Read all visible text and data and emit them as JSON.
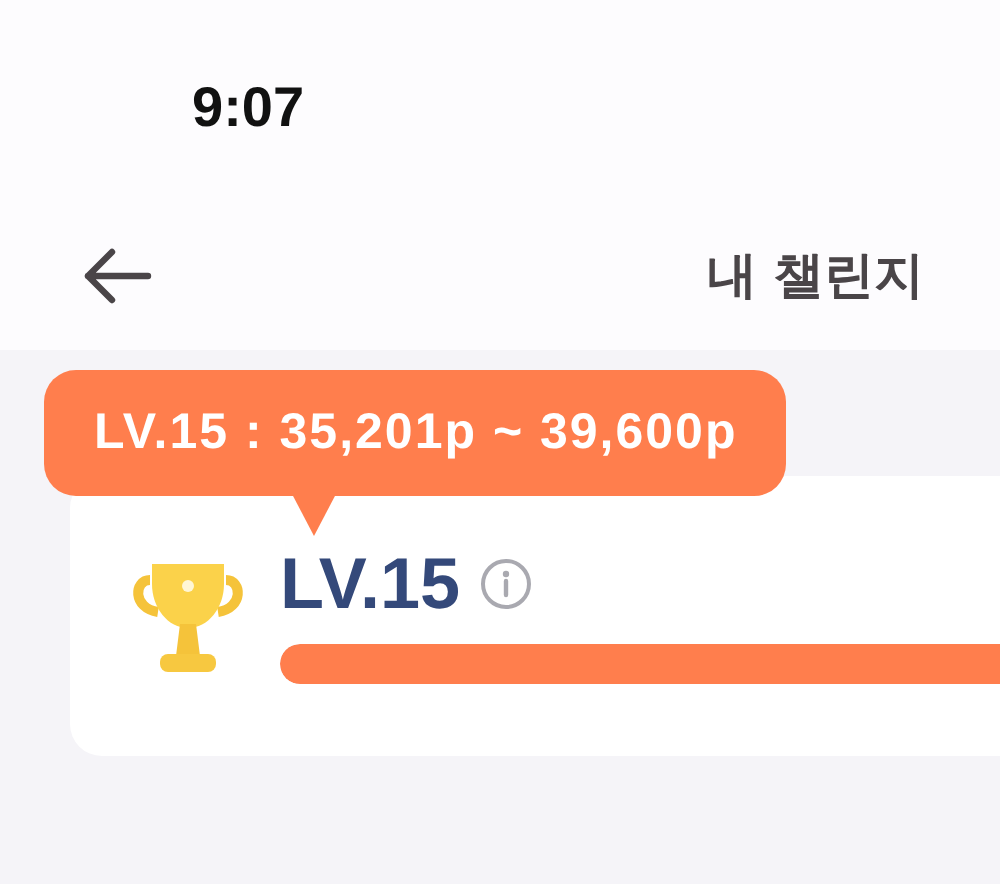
{
  "status_bar": {
    "time": "9:07"
  },
  "header": {
    "title": "내 챌린지"
  },
  "level_card": {
    "tooltip": "LV.15 : 35,201p ~ 39,600p",
    "level_label": "LV.15",
    "progress": {
      "level": 1
    }
  }
}
